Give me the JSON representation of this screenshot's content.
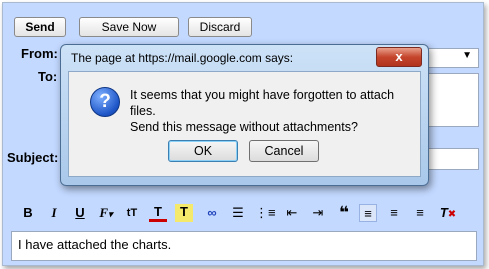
{
  "compose": {
    "send_label": "Send",
    "save_label": "Save Now",
    "discard_label": "Discard",
    "from_label": "From:",
    "to_label": "To:",
    "subject_label": "Subject:",
    "body_text": "I have attached the charts."
  },
  "toolbar": {
    "items": [
      "B",
      "I",
      "U",
      "F",
      "tT",
      "T",
      "T",
      "link",
      "numbered-list",
      "bullet-list",
      "outdent",
      "indent",
      "quote",
      "align-left",
      "align-center",
      "align-right",
      "remove-format"
    ]
  },
  "dialog": {
    "title": "The page at https://mail.google.com says:",
    "close_label": "x",
    "message_line1": "It seems that you might have forgotten to attach files.",
    "message_line2": "Send this message without attachments?",
    "ok_label": "OK",
    "cancel_label": "Cancel"
  },
  "colors": {
    "compose_bg": "#c3d9ff",
    "dialog_bg": "#cde2f7",
    "close_button": "#c5452c"
  }
}
